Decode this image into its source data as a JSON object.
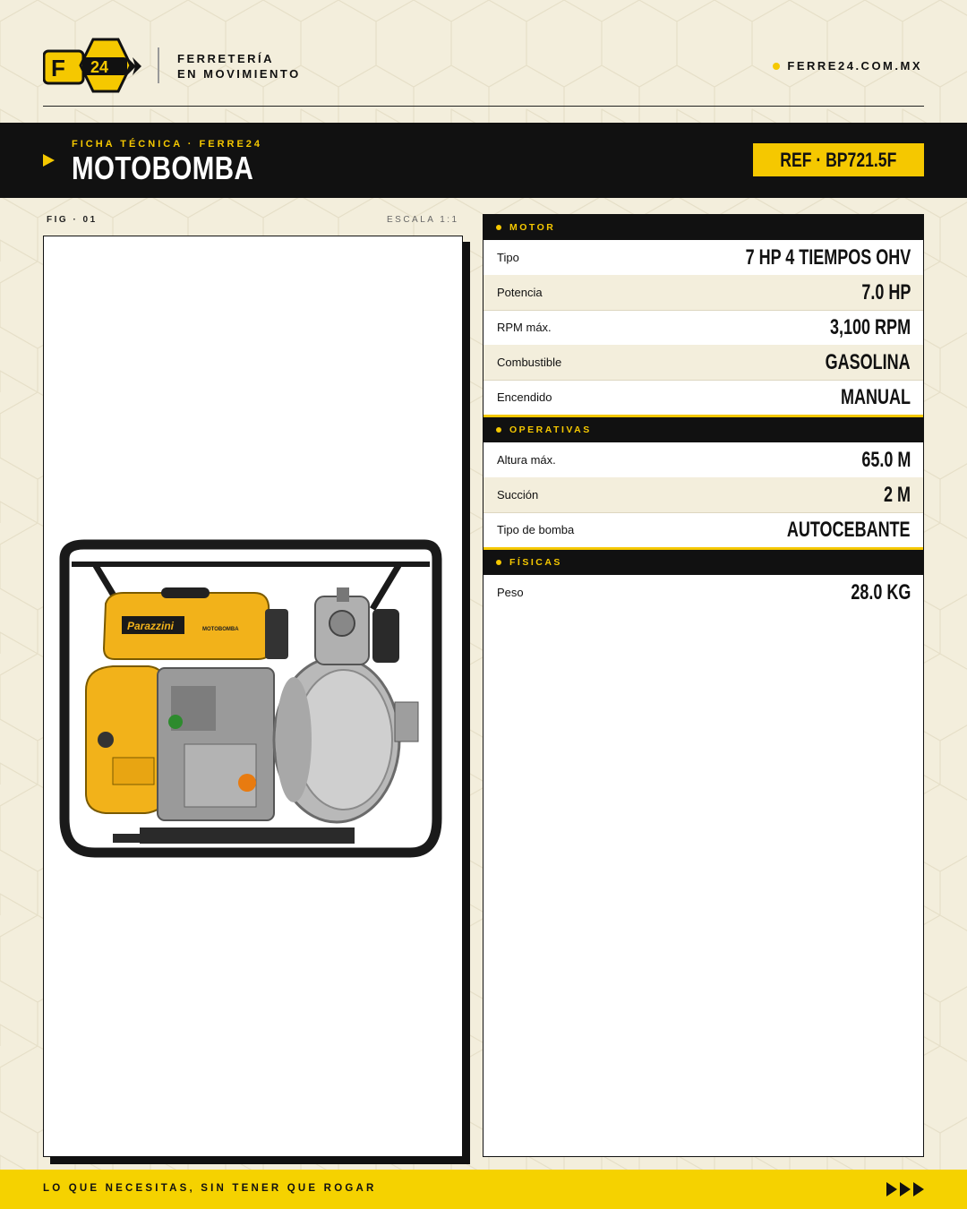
{
  "header": {
    "logo_text": "F24",
    "tagline_line1": "FERRETERÍA",
    "tagline_line2": "EN MOVIMIENTO",
    "site": "FERRE24.COM.MX"
  },
  "band": {
    "kicker": "FICHA TÉCNICA · FERRE24",
    "title": "MOTOBOMBA",
    "ref": "REF · BP721.5F"
  },
  "figure": {
    "label": "FIG · 01",
    "scale": "ESCALA 1:1",
    "product_brand": "Parazzini",
    "product_model_text": "MOTOBOMBA"
  },
  "specs": {
    "motor": {
      "title": "MOTOR",
      "rows": [
        {
          "label": "Tipo",
          "value": "7 HP 4 TIEMPOS OHV"
        },
        {
          "label": "Potencia",
          "value": "7.0 HP"
        },
        {
          "label": "RPM máx.",
          "value": "3,100 RPM"
        },
        {
          "label": "Combustible",
          "value": "GASOLINA"
        },
        {
          "label": "Encendido",
          "value": "MANUAL"
        }
      ]
    },
    "operativas": {
      "title": "OPERATIVAS",
      "rows": [
        {
          "label": "Altura máx.",
          "value": "65.0 M"
        },
        {
          "label": "Succión",
          "value": "2 M"
        },
        {
          "label": "Tipo de bomba",
          "value": "AUTOCEBANTE"
        }
      ]
    },
    "fisicas": {
      "title": "FÍSICAS",
      "rows": [
        {
          "label": "Peso",
          "value": "28.0 KG"
        }
      ]
    }
  },
  "footer": {
    "slogan": "LO QUE NECESITAS, SIN TENER QUE ROGAR"
  },
  "colors": {
    "background": "#f3eedc",
    "accent": "#f5c800",
    "dark": "#111111"
  }
}
